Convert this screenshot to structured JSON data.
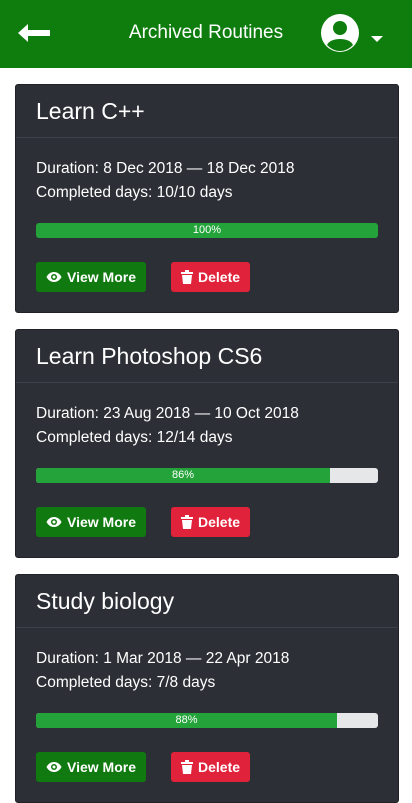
{
  "header": {
    "title": "Archived Routines",
    "back_icon": "arrow-left-icon",
    "user_icon": "user-circle-icon",
    "brand_color": "#0e7d0e"
  },
  "routines": [
    {
      "name": "Learn C++",
      "duration": "Duration: 8 Dec 2018 — 18 Dec 2018",
      "completed": "Completed days: 10/10 days",
      "progress": 1.0,
      "progress_label": "100%",
      "view_label": "View More",
      "delete_label": "Delete"
    },
    {
      "name": "Learn Photoshop CS6",
      "duration": "Duration: 23 Aug 2018 — 10 Oct 2018",
      "completed": "Completed days: 12/14 days",
      "progress": 0.86,
      "progress_label": "86%",
      "view_label": "View More",
      "delete_label": "Delete"
    },
    {
      "name": "Study biology",
      "duration": "Duration: 1 Mar 2018 — 22 Apr 2018",
      "completed": "Completed days: 7/8 days",
      "progress": 0.88,
      "progress_label": "88%",
      "view_label": "View More",
      "delete_label": "Delete"
    }
  ],
  "colors": {
    "card_bg": "#2c2f36",
    "progress_fill": "#23a33a",
    "view_button": "#107a10",
    "delete_button": "#e0223a"
  }
}
